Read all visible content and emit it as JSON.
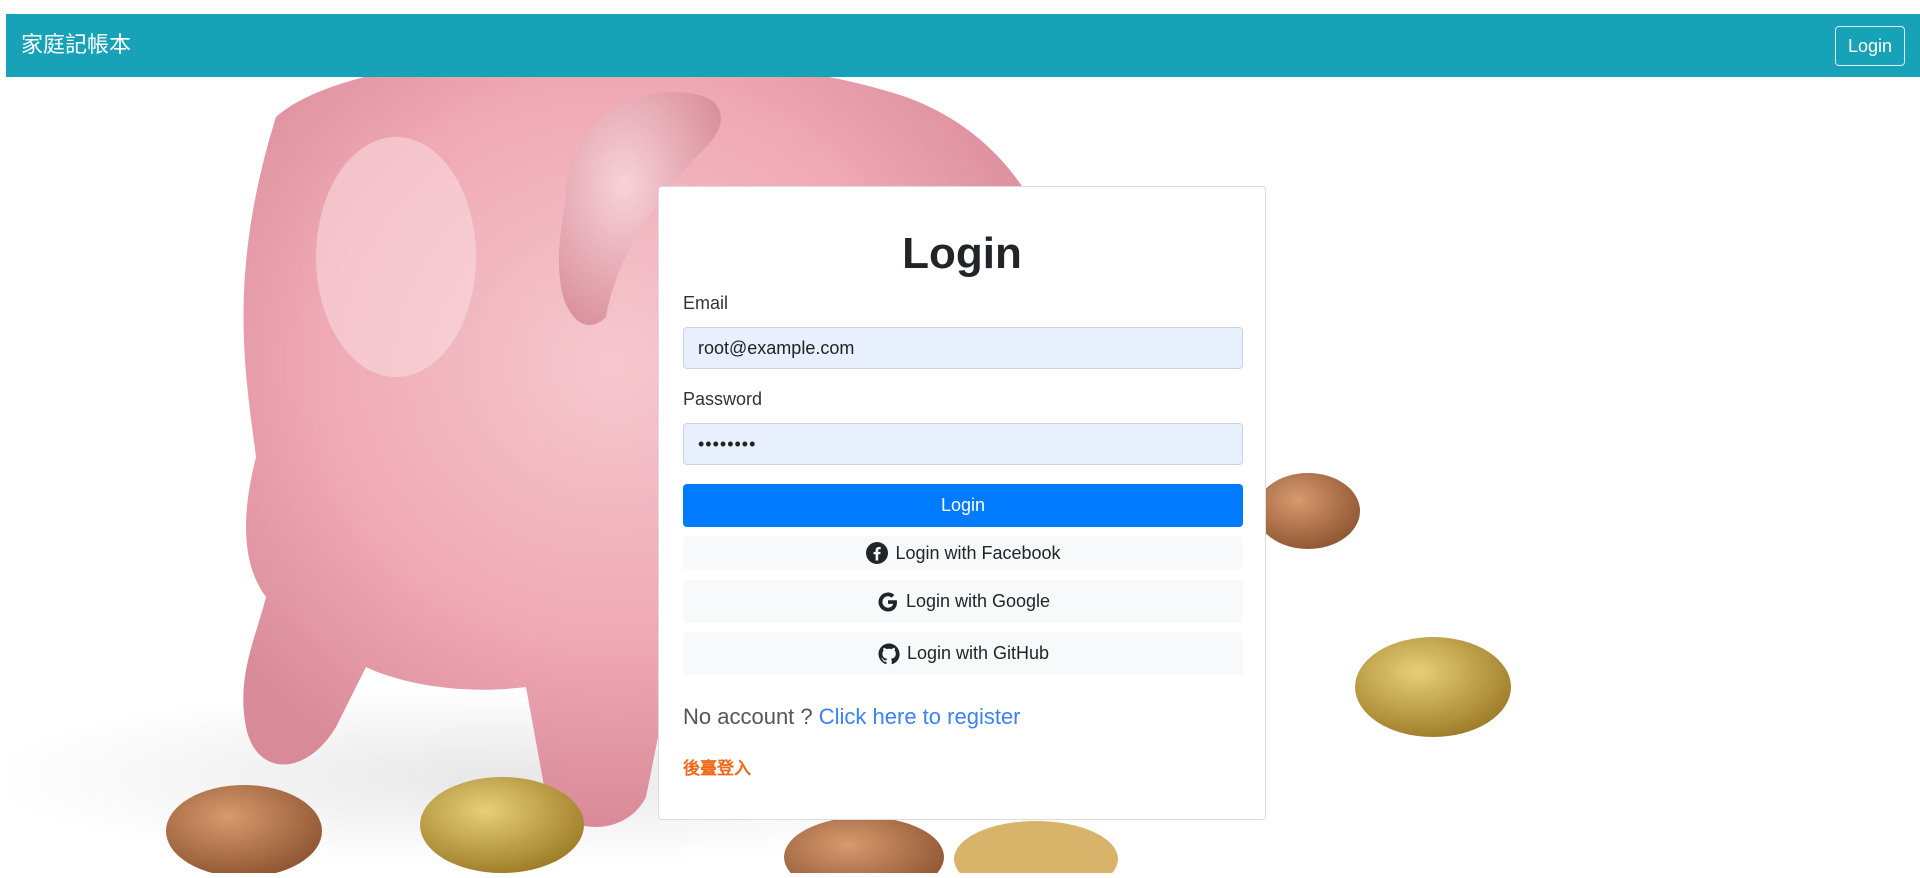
{
  "navbar": {
    "brand": "家庭記帳本",
    "login_label": "Login"
  },
  "login_card": {
    "title": "Login",
    "email_label": "Email",
    "email_value": "root@example.com",
    "password_label": "Password",
    "password_value": "••••••••",
    "login_button": "Login",
    "facebook_button": "Login with Facebook",
    "google_button": "Login with Google",
    "github_button": "Login with GitHub",
    "no_account_text": "No account ?",
    "register_link": "Click here to register",
    "admin_link": "後臺登入"
  },
  "colors": {
    "navbar": "#17a2b8",
    "primary_button": "#007bff",
    "input_bg": "#e8f0fe",
    "link": "#3b82f6",
    "admin_link": "#ee6a1a"
  },
  "icons": {
    "facebook": "facebook-icon",
    "google": "google-icon",
    "github": "github-icon"
  }
}
